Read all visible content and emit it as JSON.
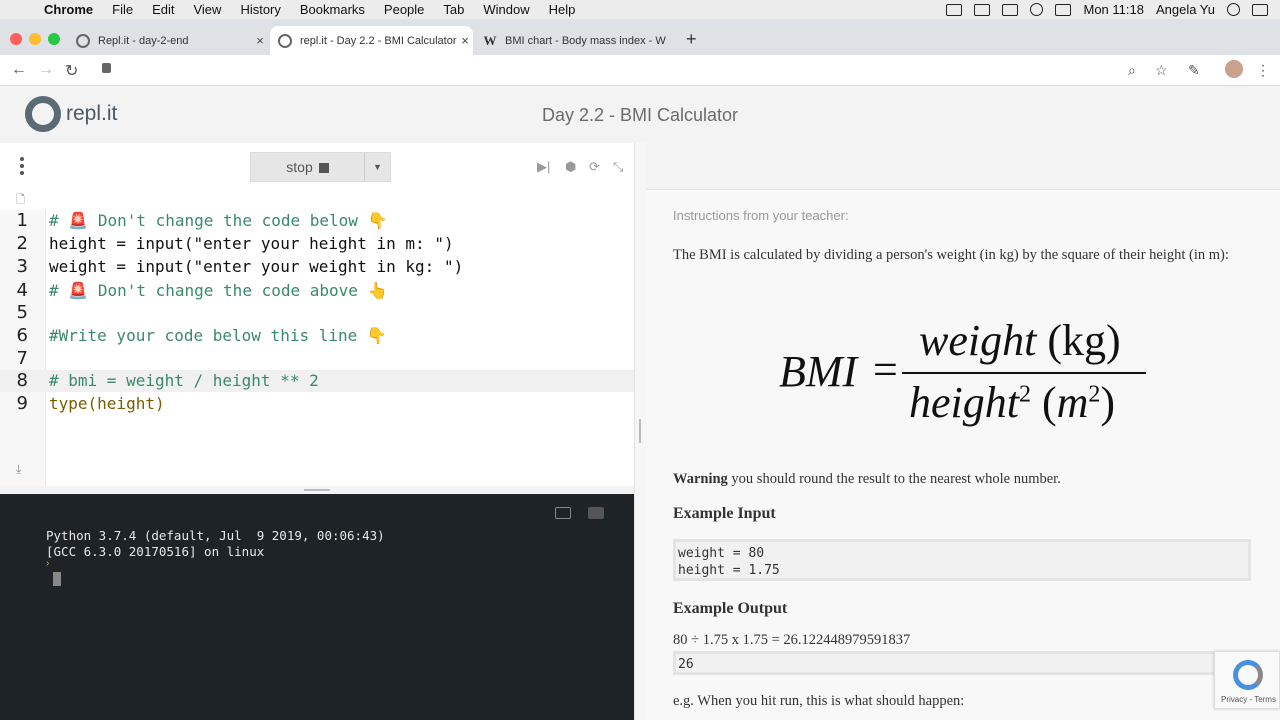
{
  "menubar": {
    "apple": "",
    "items": [
      "Chrome",
      "File",
      "Edit",
      "View",
      "History",
      "Bookmarks",
      "People",
      "Tab",
      "Window",
      "Help"
    ],
    "clock": "Mon 11:18",
    "user": "Angela Yu"
  },
  "tabs": [
    {
      "title": "Repl.it - day-2-end",
      "icon": "replit-icon"
    },
    {
      "title": "repl.it - Day 2.2 - BMI Calculator",
      "icon": "replit-icon"
    },
    {
      "title": "BMI chart - Body mass index - W",
      "icon": "wikipedia-icon",
      "favicon": "W"
    }
  ],
  "new_tab": "+",
  "repl": {
    "logo_text": "repl.it",
    "page_title": "Day 2.2 - BMI Calculator"
  },
  "editor": {
    "stop_label": "stop",
    "lines": [
      {
        "num": "1",
        "text": "# 🚨 Don't change the code below 👇",
        "kind": "comment"
      },
      {
        "num": "2",
        "text": "height = input(\"enter your height in m: \")",
        "kind": "code"
      },
      {
        "num": "3",
        "text": "weight = input(\"enter your weight in kg: \")",
        "kind": "code"
      },
      {
        "num": "4",
        "text": "# 🚨 Don't change the code above 👆",
        "kind": "comment"
      },
      {
        "num": "5",
        "text": "",
        "kind": "code"
      },
      {
        "num": "6",
        "text": "#Write your code below this line 👇",
        "kind": "comment"
      },
      {
        "num": "7",
        "text": "",
        "kind": "code"
      },
      {
        "num": "8",
        "text": "# bmi = weight / height ** 2",
        "kind": "comment"
      },
      {
        "num": "9",
        "text": "type(height)",
        "kind": "code"
      }
    ]
  },
  "console": {
    "lines": [
      "Python 3.7.4 (default, Jul  9 2019, 00:06:43)",
      "[GCC 6.3.0 20170516] on linux"
    ],
    "prompt": "›"
  },
  "instructions": {
    "from": "Instructions from your teacher:",
    "intro": "The BMI is calculated by dividing a person's weight (in kg) by the square of their height (in m):",
    "formula": {
      "lhs": "BMI",
      "eq": "=",
      "num_word": "weight",
      "num_unit": "(kg)",
      "den_word": "height",
      "den_exp": "2",
      "den_unit_open": "(",
      "den_unit": "m",
      "den_unit_exp": "2",
      "den_unit_close": ")"
    },
    "warning_bold": "Warning",
    "warning_rest": " you should round the result to the nearest whole number.",
    "example_input_heading": "Example Input",
    "example_input": "weight = 80\nheight = 1.75",
    "example_output_heading": "Example Output",
    "calc_line": "80 ÷ 1.75 x 1.75 =  26.122448979591837",
    "output_value": "26",
    "cut_line": "e.g. When you hit run, this is what should happen:"
  },
  "recaptcha": {
    "text": "Privacy - Terms"
  }
}
